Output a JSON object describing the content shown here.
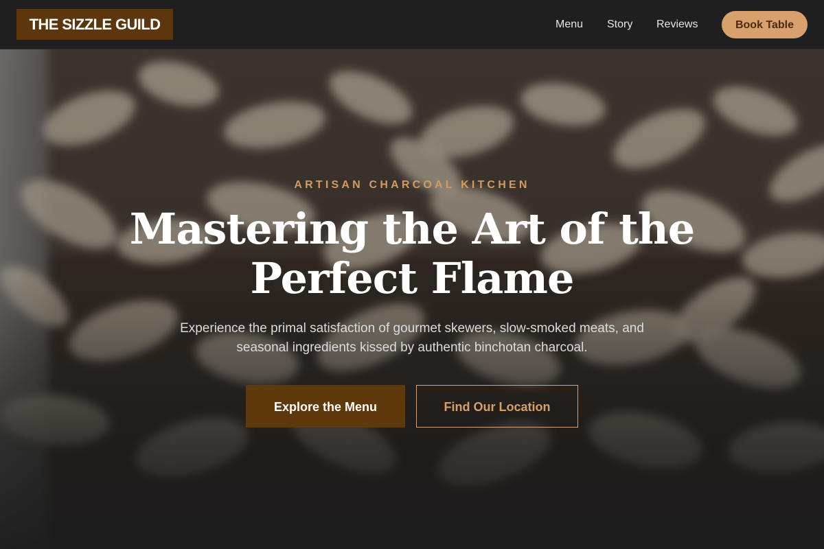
{
  "brand": {
    "name": "THE SIZZLE GUILD"
  },
  "nav": {
    "links": [
      "Menu",
      "Story",
      "Reviews"
    ],
    "cta": "Book Table"
  },
  "hero": {
    "eyebrow": "ARTISAN CHARCOAL KITCHEN",
    "headline_line1": "Mastering the Art of the",
    "headline_line2": "Perfect Flame",
    "subtext_line1": "Experience the primal satisfaction of gourmet skewers, slow-smoked meats, and",
    "subtext_line2": "seasonal ingredients kissed by authentic binchotan charcoal.",
    "primary_cta": "Explore the Menu",
    "secondary_cta": "Find Our Location",
    "background_image": "blurred-nuts-photo"
  },
  "colors": {
    "brand_brown": "#5c370d",
    "accent_tan": "#d8a06d",
    "nav_background": "#1f1f1f",
    "page_background": "#1c1c1c"
  }
}
